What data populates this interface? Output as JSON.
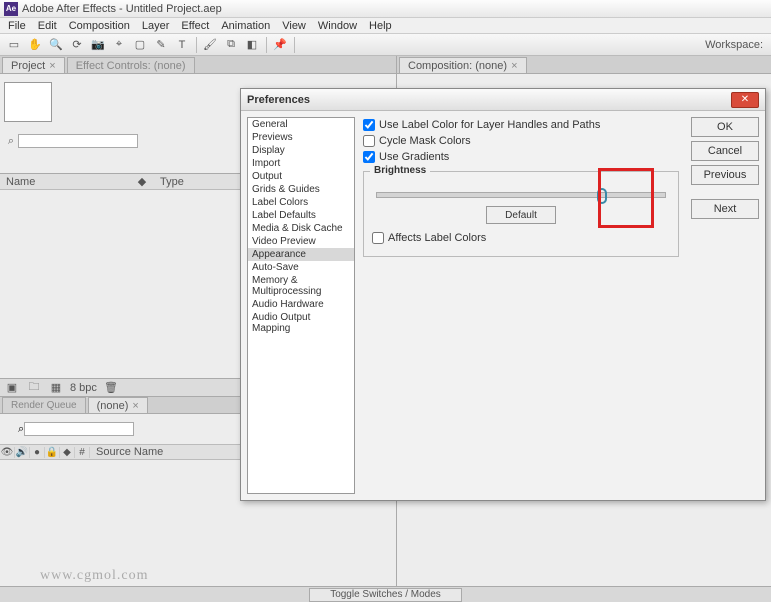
{
  "titlebar": {
    "app": "Adobe After Effects",
    "project": "Untitled Project.aep"
  },
  "menu": [
    "File",
    "Edit",
    "Composition",
    "Layer",
    "Effect",
    "Animation",
    "View",
    "Window",
    "Help"
  ],
  "toolbar": {
    "workspace_label": "Workspace:"
  },
  "panels": {
    "project_tab": "Project",
    "effect_controls_tab": "Effect Controls: (none)",
    "project_columns": {
      "name": "Name",
      "type": "Type"
    },
    "bpc": "8 bpc",
    "comp_tab": "Composition: (none)",
    "render_queue_tab": "Render Queue",
    "none_tab": "(none)",
    "timeline_cols": {
      "src": "Source Name",
      "num": "#"
    }
  },
  "footer": {
    "toggle": "Toggle Switches / Modes"
  },
  "watermark": "www.cgmol.com",
  "dialog": {
    "title": "Preferences",
    "categories": [
      "General",
      "Previews",
      "Display",
      "Import",
      "Output",
      "Grids & Guides",
      "Label Colors",
      "Label Defaults",
      "Media & Disk Cache",
      "Video Preview",
      "Appearance",
      "Auto-Save",
      "Memory & Multiprocessing",
      "Audio Hardware",
      "Audio Output Mapping"
    ],
    "selected_category": "Appearance",
    "checks": {
      "label_color": "Use Label Color for Layer Handles and Paths",
      "cycle_mask": "Cycle Mask Colors",
      "gradients": "Use Gradients",
      "affects_label": "Affects Label Colors"
    },
    "slider": {
      "legend": "Brightness",
      "default_btn": "Default",
      "pos_pct": 78
    },
    "buttons": {
      "ok": "OK",
      "cancel": "Cancel",
      "previous": "Previous",
      "next": "Next"
    }
  }
}
